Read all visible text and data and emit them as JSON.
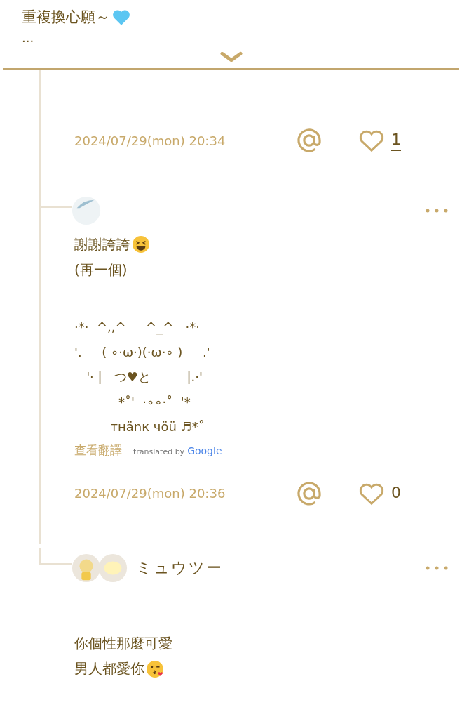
{
  "post": {
    "title": "重複換心願～",
    "title_icons": [
      {
        "kind": "blue-heart"
      }
    ],
    "ellipsis": "..."
  },
  "replies": [
    {
      "kind": "footer",
      "date": "2024/07/29(mon) 20:34",
      "likes": "1",
      "likes_link": true
    },
    {
      "kind": "single-avatar",
      "lines": [
        {
          "text": "謝謝誇誇",
          "kind": "laugh"
        },
        {
          "text": "(再一個)",
          "kind": "plain"
        }
      ],
      "kaomoji": [
        "·*·  ^,,^     ^_^   ·*·",
        "'.     ( ∘·ω·)(·ω·∘ )     .'",
        "   '· |   つ♥と         |.·'",
        "           *˚'  ·∘∘·˚  '*",
        "         тнänк чöü ♬*˚"
      ],
      "translate": {
        "label": "查看翻譯",
        "credit": "translated by",
        "brand": "Google"
      },
      "date": "2024/07/29(mon) 20:36",
      "likes": "0",
      "likes_link": false
    },
    {
      "kind": "double-avatar",
      "author": "ミュウツー",
      "lines": [
        {
          "text": "你個性那麼可愛",
          "kind": "plain"
        },
        {
          "text": "男人都愛你",
          "kind": "kiss"
        }
      ]
    }
  ]
}
